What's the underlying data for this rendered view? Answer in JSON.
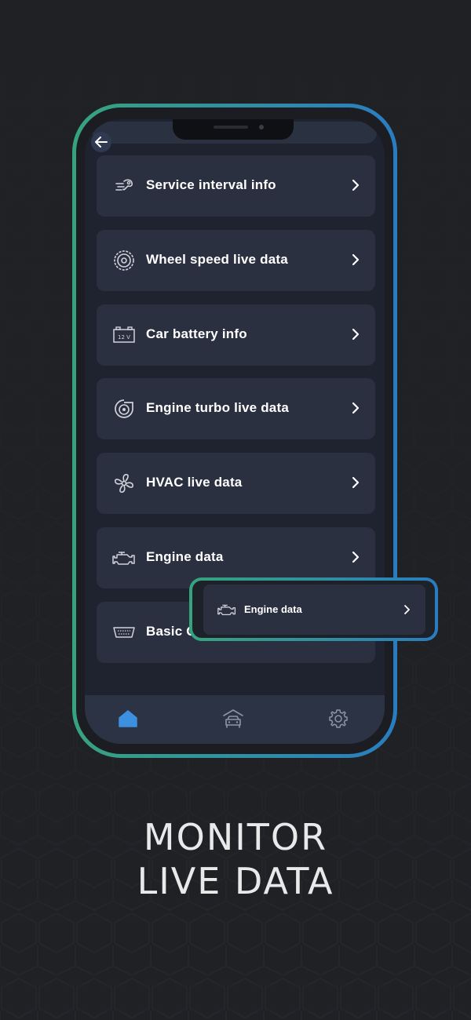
{
  "menu": {
    "items": [
      {
        "label": "Service interval info",
        "icon": "service-interval-icon"
      },
      {
        "label": "Wheel speed live data",
        "icon": "wheel-icon"
      },
      {
        "label": "Car battery info",
        "icon": "battery-icon"
      },
      {
        "label": "Engine turbo live data",
        "icon": "turbo-icon"
      },
      {
        "label": "HVAC live data",
        "icon": "fan-icon"
      },
      {
        "label": "Engine data",
        "icon": "engine-icon"
      },
      {
        "label": "Basic O",
        "icon": "obd-connector-icon"
      }
    ]
  },
  "battery_icon_text": "12 V",
  "popout": {
    "label": "Engine data",
    "icon": "engine-icon"
  },
  "bottom_nav": {
    "items": [
      {
        "icon": "home-icon",
        "active": true
      },
      {
        "icon": "garage-car-icon",
        "active": false
      },
      {
        "icon": "gear-icon",
        "active": false
      }
    ]
  },
  "headline": {
    "line1": "MONITOR",
    "line2": "LIVE DATA"
  },
  "colors": {
    "background": "#1f2125",
    "card": "#2a3040",
    "screen": "#1f2330",
    "accent_green": "#37a37d",
    "accent_blue": "#2a7cc0",
    "active_nav": "#3d8fe0"
  }
}
